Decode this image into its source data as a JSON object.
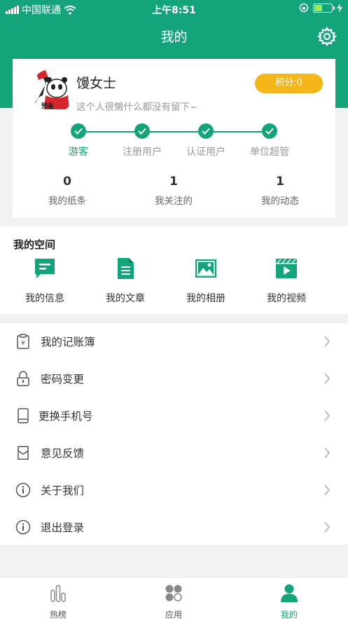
{
  "status_bar": {
    "carrier": "中国联通",
    "time": "上午8:51",
    "battery_level": 0.45
  },
  "nav": {
    "title": "我的"
  },
  "profile": {
    "name": "馒女士",
    "signature": "这个人很懒什么都没有留下~",
    "points_label": "积分:0",
    "avatar_text": "预备"
  },
  "levels": [
    {
      "label": "游客",
      "active": true
    },
    {
      "label": "注册用户",
      "active": false
    },
    {
      "label": "认证用户",
      "active": false
    },
    {
      "label": "单位超管",
      "active": false
    }
  ],
  "stats": [
    {
      "value": "0",
      "label": "我的纸条"
    },
    {
      "value": "1",
      "label": "我关注的"
    },
    {
      "value": "1",
      "label": "我的动态"
    }
  ],
  "space": {
    "title": "我的空间",
    "items": [
      {
        "label": "我的信息",
        "icon": "message-icon"
      },
      {
        "label": "我的文章",
        "icon": "document-icon"
      },
      {
        "label": "我的相册",
        "icon": "photo-icon"
      },
      {
        "label": "我的视频",
        "icon": "video-icon"
      }
    ]
  },
  "menu": [
    {
      "label": "我的记账簿",
      "icon": "ledger-icon"
    },
    {
      "label": "密码变更",
      "icon": "lock-icon"
    },
    {
      "label": "更换手机号",
      "icon": "phone-icon"
    },
    {
      "label": "意见反馈",
      "icon": "feedback-icon"
    },
    {
      "label": "关于我们",
      "icon": "info-icon"
    },
    {
      "label": "退出登录",
      "icon": "info-icon"
    }
  ],
  "tabs": [
    {
      "label": "热榜",
      "icon": "bar-chart-icon",
      "active": false
    },
    {
      "label": "应用",
      "icon": "apps-icon",
      "active": false
    },
    {
      "label": "我的",
      "icon": "person-icon",
      "active": true
    }
  ],
  "colors": {
    "primary": "#14a47a",
    "points_badge": "#f5b61a"
  }
}
